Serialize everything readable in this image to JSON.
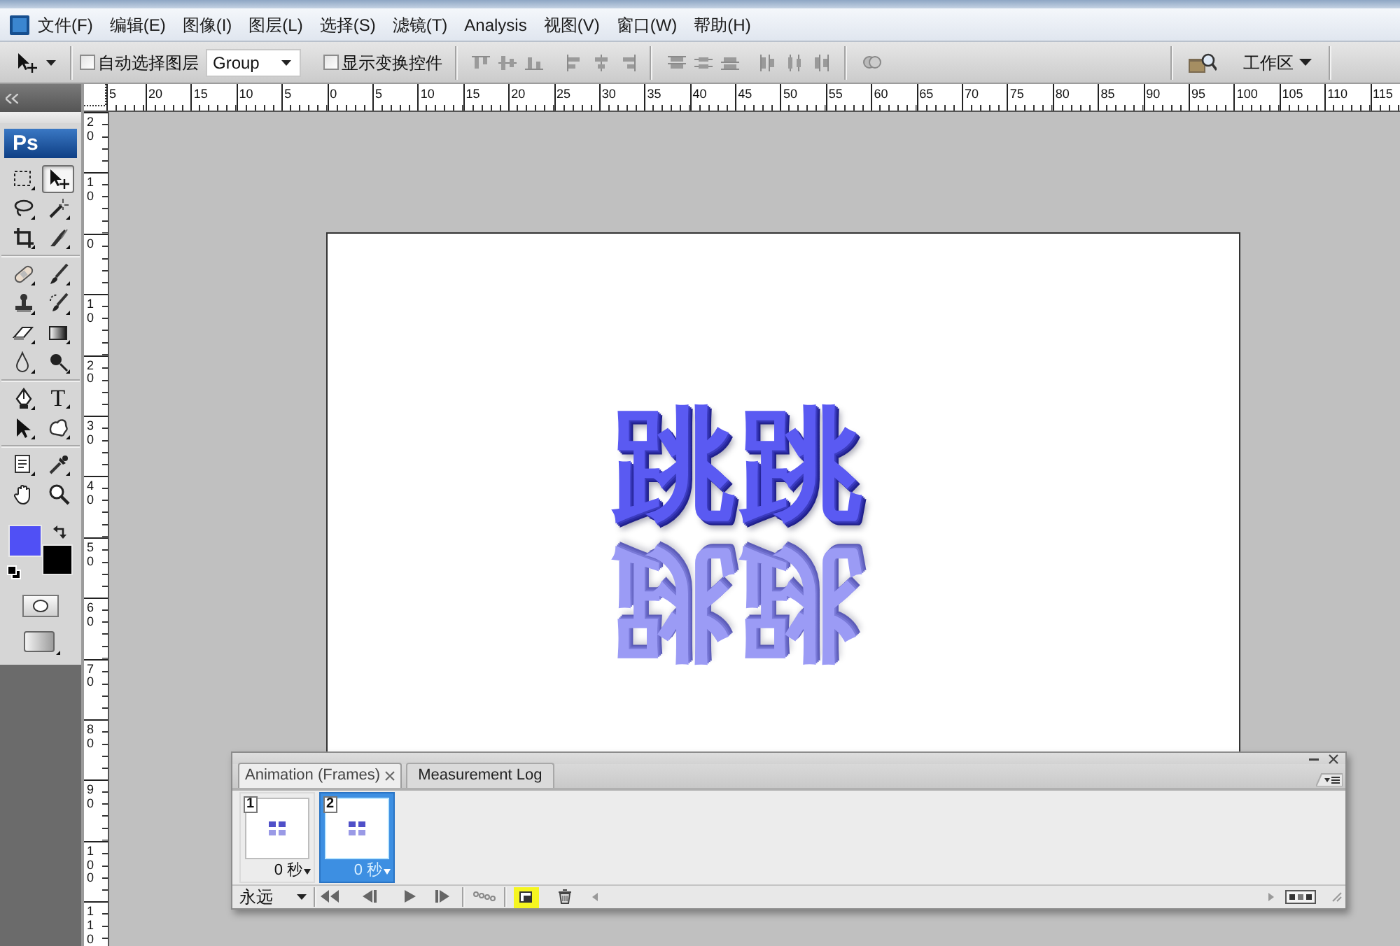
{
  "menu_bar": {
    "items": [
      "文件(F)",
      "编辑(E)",
      "图像(I)",
      "图层(L)",
      "选择(S)",
      "滤镜(T)",
      "Analysis",
      "视图(V)",
      "窗口(W)",
      "帮助(H)"
    ]
  },
  "options_bar": {
    "auto_select": {
      "label": "自动选择图层",
      "checked": false
    },
    "auto_select_target": {
      "value": "Group"
    },
    "show_transform_controls": {
      "label": "显示变换控件",
      "checked": false
    },
    "workspace": {
      "label": "工作区"
    }
  },
  "toolbox": {
    "logo": "Ps",
    "tools": [
      {
        "kind": "marquee",
        "selected": false
      },
      {
        "kind": "move",
        "selected": true
      },
      {
        "kind": "lasso",
        "selected": false
      },
      {
        "kind": "wand",
        "selected": false
      },
      {
        "kind": "crop",
        "selected": false
      },
      {
        "kind": "slice",
        "selected": false
      },
      {
        "kind": "healing",
        "selected": false
      },
      {
        "kind": "brush",
        "selected": false
      },
      {
        "kind": "stamp",
        "selected": false
      },
      {
        "kind": "history",
        "selected": false
      },
      {
        "kind": "eraser",
        "selected": false
      },
      {
        "kind": "gradient",
        "selected": false
      },
      {
        "kind": "blur",
        "selected": false
      },
      {
        "kind": "dodge",
        "selected": false
      },
      {
        "kind": "pen",
        "selected": false
      },
      {
        "kind": "type",
        "label": "T",
        "selected": false
      },
      {
        "kind": "pathselect",
        "selected": false
      },
      {
        "kind": "shape",
        "selected": false
      },
      {
        "kind": "notes",
        "selected": false
      },
      {
        "kind": "eyedropper",
        "selected": false
      },
      {
        "kind": "hand",
        "selected": false
      },
      {
        "kind": "zoom",
        "selected": false
      }
    ],
    "colors": [
      {
        "color": "#5050f5"
      },
      {
        "color": "#000000"
      }
    ]
  },
  "rulers": {
    "horizontal": [
      "5",
      "20",
      "15",
      "10",
      "5",
      "0",
      "5",
      "10",
      "15",
      "20",
      "25",
      "30",
      "35",
      "40",
      "45",
      "50",
      "55",
      "60",
      "65",
      "70",
      "75",
      "80",
      "85",
      "90",
      "95",
      "100",
      "105",
      "110",
      "115"
    ],
    "vertical": [
      "20",
      "10",
      "0",
      "10",
      "20",
      "30",
      "40",
      "50",
      "60",
      "70",
      "80",
      "90",
      "100",
      "110"
    ]
  },
  "document": {
    "artwork": [
      {
        "kind": "text",
        "text": "跳跳"
      },
      {
        "kind": "reflection",
        "text": "跳跳"
      }
    ]
  },
  "animation_panel": {
    "tabs": [
      {
        "label": "Animation (Frames)",
        "selected": true
      },
      {
        "label": "Measurement Log",
        "selected": false
      }
    ],
    "frames": [
      {
        "number": "1",
        "delay": "0 秒",
        "selected": false
      },
      {
        "number": "2",
        "delay": "0 秒",
        "selected": true
      }
    ],
    "loop": "永远",
    "controls": [
      {
        "kind": "first",
        "highlighted": false
      },
      {
        "kind": "previous",
        "highlighted": false
      },
      {
        "kind": "play",
        "highlighted": false
      },
      {
        "kind": "next",
        "highlighted": false
      },
      {
        "kind": "tween",
        "highlighted": false
      },
      {
        "kind": "new",
        "highlighted": true
      },
      {
        "kind": "delete",
        "highlighted": false
      }
    ]
  }
}
